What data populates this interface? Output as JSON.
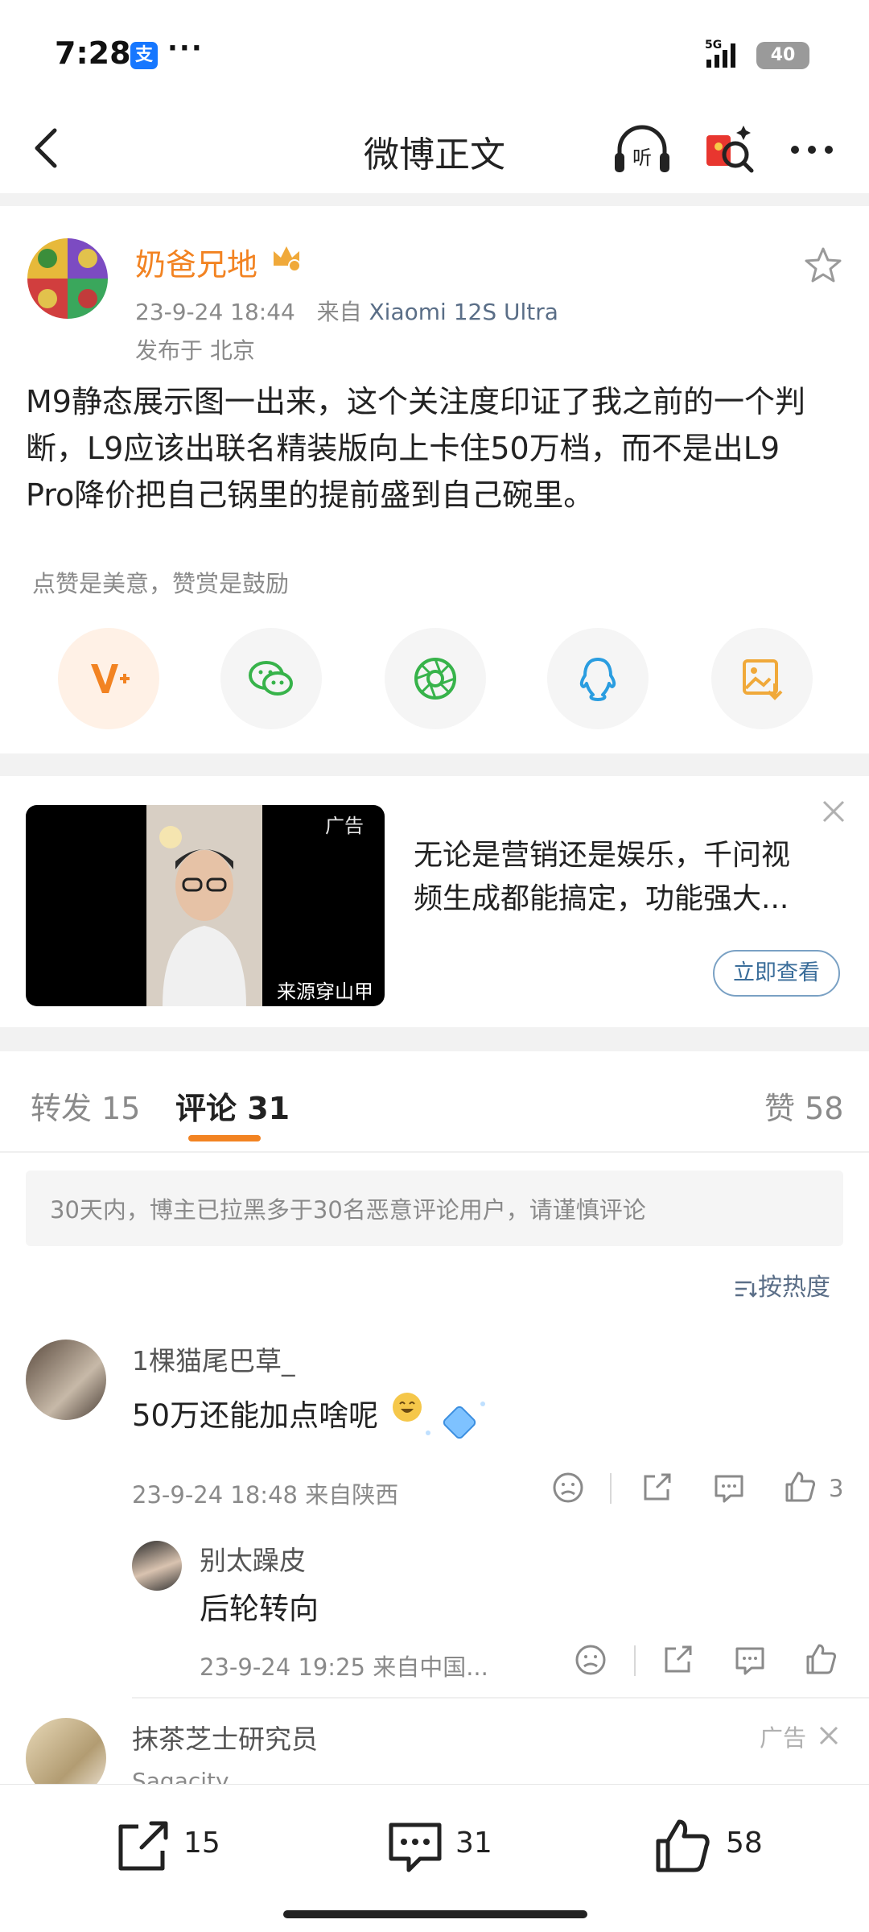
{
  "status_bar": {
    "time": "7:28",
    "app_badge": "支",
    "more": "···",
    "network": "5G",
    "battery": "40"
  },
  "nav": {
    "title": "微博正文",
    "listen_label": "听"
  },
  "post": {
    "author": "奶爸兄地",
    "timestamp": "23-9-24 18:44",
    "source_prefix": "来自",
    "device": "Xiaomi 12S Ultra",
    "location": "发布于 北京",
    "body_lines": [
      "M9静态展示图一出来，这个关注度印证了我之前的一个判",
      "断，L9应该出联名精装版向上卡住50万档，而不是出L9",
      "Pro降价把自己锅里的提前盛到自己碗里。"
    ],
    "reward_hint": "点赞是美意，赞赏是鼓励"
  },
  "ad": {
    "tag": "广告",
    "source": "来源穿山甲",
    "text_lines": [
      "无论是营销还是娱乐，千问视",
      "频生成都能搞定，功能强大..."
    ],
    "button": "立即查看"
  },
  "tabs": {
    "reposts": "转发 15",
    "comments": "评论 31",
    "likes": "赞 58"
  },
  "notice": "30天内，博主已拉黑多于30名恶意评论用户，请谨慎评论",
  "sort_label": "按热度",
  "comments": [
    {
      "user": "1棵猫尾巴草_",
      "text": "50万还能加点啥呢",
      "meta": "23-9-24 18:48  来自陕西",
      "likes": "3",
      "reply": {
        "user": "别太躁皮",
        "text": "后轮转向",
        "meta": "23-9-24 19:25  来自中国..."
      }
    },
    {
      "user": "抹茶芝士研究员",
      "sub": "Sagacity",
      "ad_tag": "广告"
    }
  ],
  "bottom_bar": {
    "reposts": "15",
    "comments": "31",
    "likes": "58"
  },
  "colors": {
    "accent": "#f28322",
    "link": "#5a6e87",
    "divider": "#f2f2f2"
  },
  "icons": [
    "back-icon",
    "listen-icon",
    "red-packet-icon",
    "more-icon",
    "star-icon",
    "wechat-icon",
    "moments-icon",
    "qq-icon",
    "save-image-icon",
    "close-icon",
    "repost-icon",
    "comment-icon",
    "like-icon",
    "dislike-icon"
  ]
}
